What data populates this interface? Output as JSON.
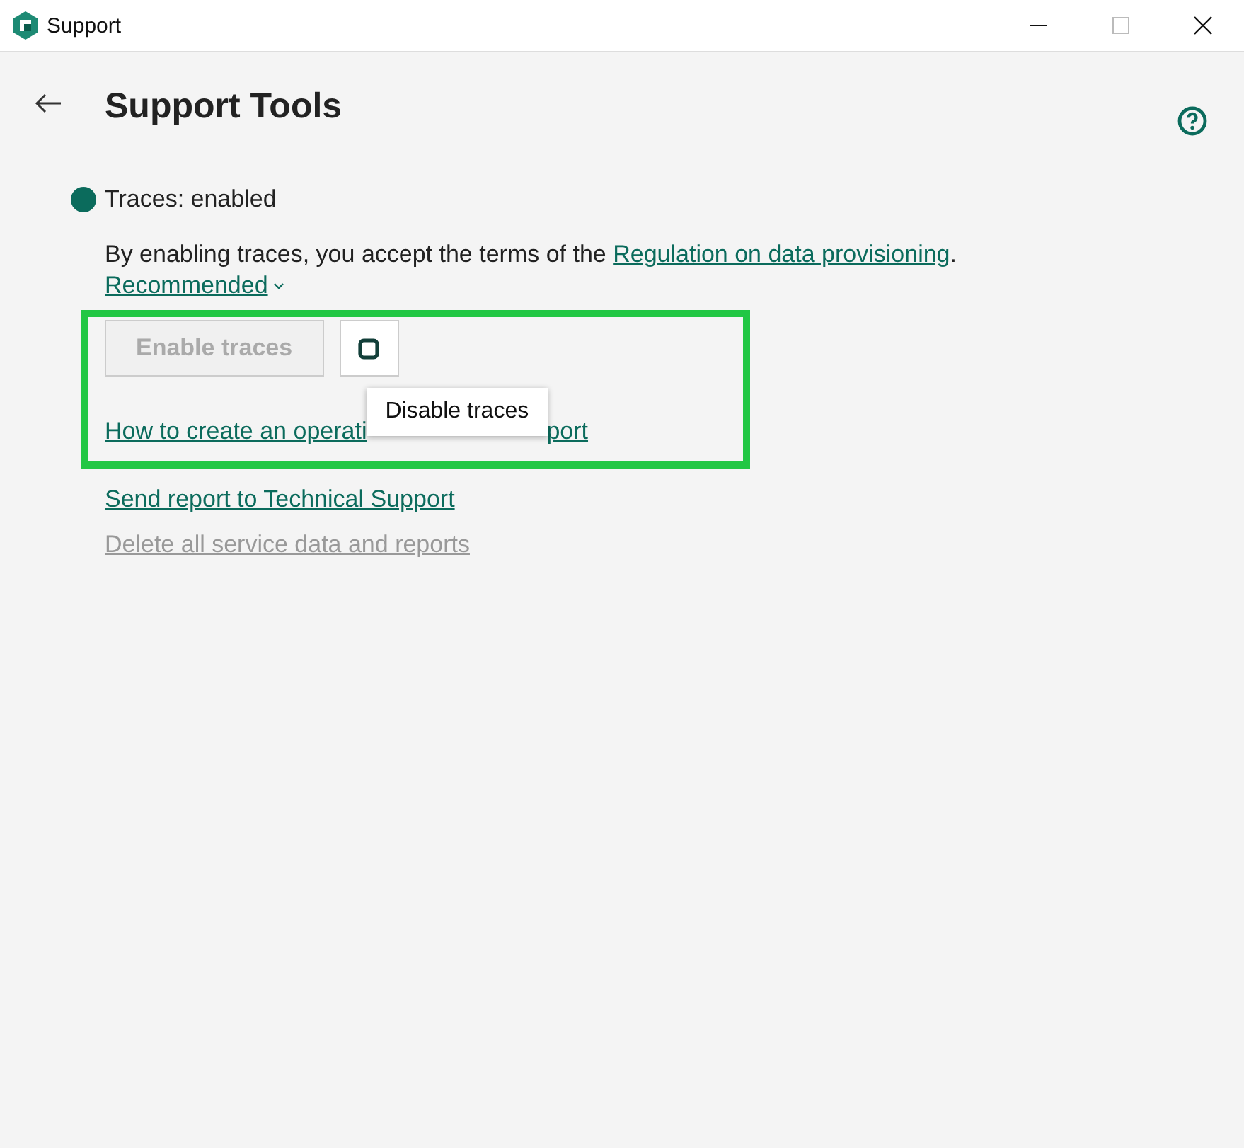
{
  "window": {
    "title": "Support"
  },
  "page": {
    "title": "Support Tools"
  },
  "status": {
    "text": "Traces: enabled",
    "on": true
  },
  "terms": {
    "text": "By enabling traces, you accept the terms of the ",
    "link": "Regulation on data provisioning",
    "end": "."
  },
  "level_dropdown": {
    "label": "Recommended",
    "expanded": false
  },
  "controls": {
    "highlighted": true,
    "buttons": [
      {
        "kind": "text",
        "label": "Enable traces",
        "disabled": true
      },
      {
        "kind": "stop",
        "disabled": false
      }
    ],
    "tooltip": "Disable traces",
    "link_parts": [
      "How to create an operati",
      "port"
    ]
  },
  "links": [
    {
      "label": "Send report to Technical Support",
      "disabled": false
    },
    {
      "label": "Delete all service data and reports",
      "disabled": true
    }
  ]
}
